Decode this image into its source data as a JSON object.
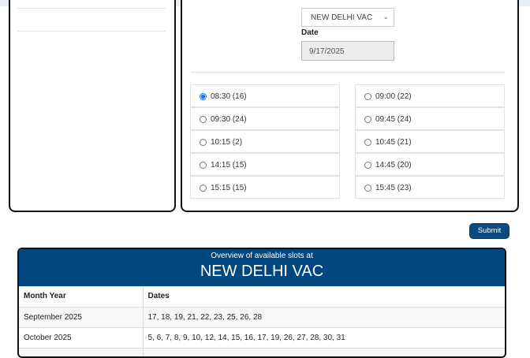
{
  "form": {
    "centre_select": "NEW DELHI VAC",
    "date_label": "Date",
    "date_value": "9/17/2025",
    "slots": [
      {
        "label": "08:30 (16)",
        "selected": true
      },
      {
        "label": "09:00 (22)",
        "selected": false
      },
      {
        "label": "09:30 (24)",
        "selected": false
      },
      {
        "label": "09:45 (24)",
        "selected": false
      },
      {
        "label": "10:15 (2)",
        "selected": false
      },
      {
        "label": "10:45 (21)",
        "selected": false
      },
      {
        "label": "14:15 (15)",
        "selected": false
      },
      {
        "label": "14:45 (20)",
        "selected": false
      },
      {
        "label": "15:15 (15)",
        "selected": false
      },
      {
        "label": "15:45 (23)",
        "selected": false
      }
    ],
    "submit_label": "Submit"
  },
  "overview": {
    "subtitle": "Overview of available slots at",
    "title": "NEW DELHI VAC",
    "columns": [
      "Month Year",
      "Dates"
    ],
    "rows": [
      {
        "month": "September 2025",
        "dates": "17, 18, 19, 21, 22, 23, 25, 26, 28"
      },
      {
        "month": "October 2025",
        "dates": "5, 6, 7, 8, 9, 10, 12, 14, 15, 16, 17, 19, 26, 27, 28, 30, 31"
      }
    ]
  },
  "colors": {
    "primary": "#004680",
    "button": "#0d4a80",
    "radio": "#1a73e8"
  }
}
